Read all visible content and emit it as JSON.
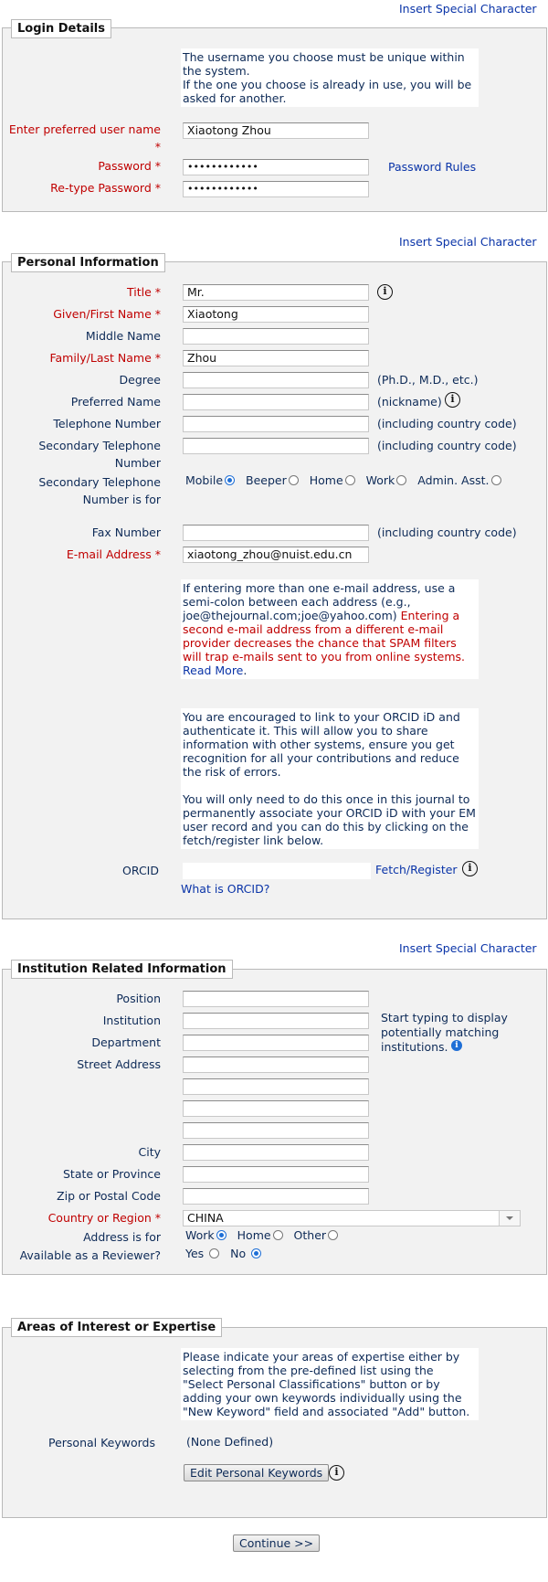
{
  "insert_special_character": "Insert Special Character",
  "login": {
    "legend": "Login Details",
    "info": "The username you choose must be unique within the system.\nIf the one you choose is already in use, you will be asked for another.",
    "username_label": "Enter preferred user name *",
    "username_value": "Xiaotong Zhou",
    "password_label": "Password *",
    "password_value": "••••••••••••",
    "password_rules": "Password Rules",
    "retype_label": "Re-type Password *",
    "retype_value": "••••••••••••"
  },
  "personal": {
    "legend": "Personal Information",
    "title_label": "Title *",
    "title_value": "Mr.",
    "given_label": "Given/First Name *",
    "given_value": "Xiaotong",
    "middle_label": "Middle Name",
    "family_label": "Family/Last Name *",
    "family_value": "Zhou",
    "degree_label": "Degree",
    "degree_hint": "(Ph.D., M.D., etc.)",
    "preferred_label": "Preferred Name",
    "preferred_hint": "(nickname)",
    "phone_label": "Telephone Number",
    "phone_hint": "(including country code)",
    "sec_phone_label": "Secondary Telephone Number",
    "sec_phone_hint": "(including country code)",
    "sec_for_label": "Secondary Telephone Number is for",
    "sec_for_options": [
      "Mobile",
      "Beeper",
      "Home",
      "Work",
      "Admin. Asst."
    ],
    "sec_for_selected": "Mobile",
    "fax_label": "Fax Number",
    "fax_hint": "(including country code)",
    "email_label": "E-mail Address *",
    "email_value": "xiaotong_zhou@nuist.edu.cn",
    "email_info_a": "If entering more than one e-mail address, use a semi-colon between each address (e.g., joe@thejournal.com;joe@yahoo.com) ",
    "email_info_b": "Entering a second e-mail address from a different e-mail provider decreases the chance that SPAM filters will trap e-mails sent to you from online systems.",
    "read_more": "Read More",
    "orcid_info_1": "You are encouraged to link to your ORCID iD and authenticate it. This will allow you to share information with other systems, ensure you get recognition for all your contributions and reduce the risk of errors.",
    "orcid_info_2": "You will only need to do this once in this journal to permanently associate your ORCID iD with your EM user record and you can do this by clicking on the fetch/register link below.",
    "orcid_label": "ORCID",
    "fetch_register": "Fetch/Register",
    "what_is_orcid": "What is ORCID?"
  },
  "institution": {
    "legend": "Institution Related Information",
    "position_label": "Position",
    "institution_label": "Institution",
    "institution_hint": "Start typing to display potentially matching institutions.",
    "department_label": "Department",
    "street_label": "Street Address",
    "city_label": "City",
    "state_label": "State or Province",
    "zip_label": "Zip or Postal Code",
    "country_label": "Country or Region *",
    "country_value": "CHINA",
    "address_for_label": "Address is for",
    "address_for_options": [
      "Work",
      "Home",
      "Other"
    ],
    "address_for_selected": "Work",
    "reviewer_label": "Available as a Reviewer?",
    "reviewer_options": [
      "Yes",
      "No"
    ],
    "reviewer_selected": "No"
  },
  "areas": {
    "legend": "Areas of Interest or Expertise",
    "info": "Please indicate your areas of expertise either by selecting from the pre-defined list using the \"Select Personal Classifications\" button or by adding your own keywords individually using the \"New Keyword\" field and associated \"Add\" button.",
    "keywords_label": "Personal Keywords",
    "keywords_value": "(None Defined)",
    "edit_button": "Edit Personal Keywords"
  },
  "continue_button": "Continue >>"
}
